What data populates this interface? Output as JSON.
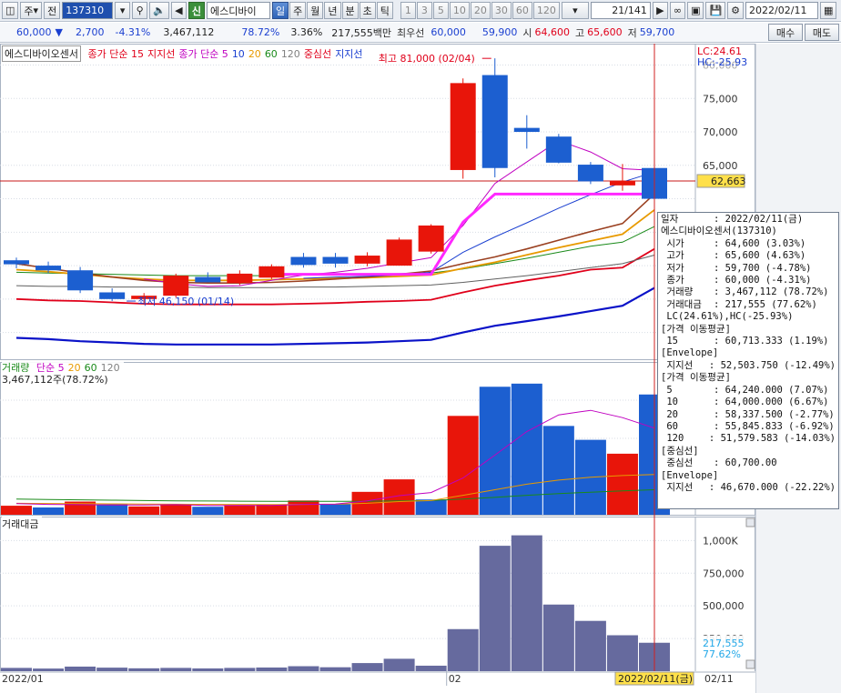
{
  "toolbar": {
    "market": "주",
    "scope": "전",
    "code": "137310",
    "stock_name": "에스디바이",
    "new_badge": "신",
    "periods": [
      {
        "label": "일",
        "active": true
      },
      {
        "label": "주",
        "active": false
      },
      {
        "label": "월",
        "active": false
      },
      {
        "label": "년",
        "active": false
      },
      {
        "label": "분",
        "active": false
      },
      {
        "label": "초",
        "active": false
      },
      {
        "label": "틱",
        "active": false
      }
    ],
    "intervals": [
      "1",
      "3",
      "5",
      "10",
      "20",
      "30",
      "60",
      "120"
    ],
    "page": "21/141",
    "date": "2022/02/11"
  },
  "price_row": {
    "price": "60,000",
    "down_arrow": "▼",
    "change": "2,700",
    "change_pct": "-4.31%",
    "volume": "3,467,112",
    "volume_ratio": "78.72%",
    "turnover_pct": "3.36%",
    "amount": "217,555백만",
    "best_label": "최우선",
    "best_price": "60,000",
    "best_price2": "59,900",
    "open_label": "시",
    "open": "64,600",
    "high_label": "고",
    "high": "65,600",
    "low_label": "저",
    "low": "59,700",
    "buy_label": "매수",
    "sell_label": "매도"
  },
  "price_panel": {
    "legend_name": "에스디바이오센서",
    "legend_items": [
      {
        "text": "종가 단순 15",
        "color": "#e0001a"
      },
      {
        "text": "지지선",
        "color": "#e0001a"
      },
      {
        "text": "종가 단순 5",
        "color": "#c000c0"
      },
      {
        "text": "10",
        "color": "#1a3fd0"
      },
      {
        "text": "20",
        "color": "#e89a00"
      },
      {
        "text": "60",
        "color": "#1a8a1a"
      },
      {
        "text": "120",
        "color": "#808080"
      },
      {
        "text": "중심선",
        "color": "#e0001a"
      },
      {
        "text": "지지선",
        "color": "#1a3fd0"
      }
    ],
    "high_note": "최고 81,000 (02/04)",
    "low_note": "최저 46,150 (01/14)",
    "lc": "LC:24.61",
    "hc": "HC:-25.93",
    "y_ticks": [
      "75,000",
      "70,000",
      "65,000",
      "80,000"
    ],
    "current_price_tag": "62,663"
  },
  "volume_panel": {
    "legend_title": "거래량",
    "legend_items": [
      {
        "text": "단순 5",
        "color": "#c000c0"
      },
      {
        "text": "20",
        "color": "#e89a00"
      },
      {
        "text": "60",
        "color": "#1a8a1a"
      },
      {
        "text": "120",
        "color": "#808080"
      }
    ],
    "current_label": "3,467,112주(78.72%)"
  },
  "amount_panel": {
    "legend_title": "거래대금",
    "y_ticks": [
      "1,000K",
      "750,000",
      "500,000",
      "250,000"
    ],
    "current_tag": "217,555",
    "current_pct": "77.62%"
  },
  "x_axis": {
    "labels": [
      "2022/01",
      "02"
    ],
    "cursor_date": "2022/02/11(금)",
    "right_label": "02/11"
  },
  "popup": {
    "lines": [
      {
        "k": "일자",
        "v": ": 2022/02/11(금)"
      },
      {
        "k": "",
        "v": "에스디바이오센서(137310)"
      },
      {
        "k": " 시가",
        "v": ": 64,600 (3.03%)"
      },
      {
        "k": " 고가",
        "v": ": 65,600 (4.63%)"
      },
      {
        "k": " 저가",
        "v": ": 59,700 (-4.78%)"
      },
      {
        "k": " 종가",
        "v": ": 60,000 (-4.31%)"
      },
      {
        "k": " 거래량",
        "v": ": 3,467,112 (78.72%)"
      },
      {
        "k": " 거래대금",
        "v": ": 217,555 (77.62%)"
      },
      {
        "k": "",
        "v": " LC(24.61%),HC(-25.93%)"
      },
      {
        "k": "",
        "v": "[가격 이동평균]"
      },
      {
        "k": " 15",
        "v": ": 60,713.333 (1.19%)"
      },
      {
        "k": "",
        "v": "[Envelope]"
      },
      {
        "k": " 지지선",
        "v": ": 52,503.750 (-12.49%)"
      },
      {
        "k": "",
        "v": "[가격 이동평균]"
      },
      {
        "k": " 5",
        "v": ": 64,240.000 (7.07%)"
      },
      {
        "k": " 10",
        "v": ": 64,000.000 (6.67%)"
      },
      {
        "k": " 20",
        "v": ": 58,337.500 (-2.77%)"
      },
      {
        "k": " 60",
        "v": ": 55,845.833 (-6.92%)"
      },
      {
        "k": " 120",
        "v": ": 51,579.583 (-14.03%)"
      },
      {
        "k": "",
        "v": "[중심선]"
      },
      {
        "k": " 중심선",
        "v": ": 60,700.00"
      },
      {
        "k": "",
        "v": "[Envelope]"
      },
      {
        "k": " 지지선",
        "v": ": 46,670.000 (-22.22%)"
      }
    ]
  },
  "colors": {
    "up": "#e8150a",
    "down": "#1c5fd0",
    "ma5": "#c000c0",
    "ma10": "#1a3fd0",
    "ma20": "#e89a00",
    "ma60": "#1a8a1a",
    "ma120": "#606060",
    "ma15": "#9a4020",
    "center": "#ff28ff",
    "env_upper": "#e0001a",
    "env_lower": "#0a12c8",
    "amount_bar": "#666a9e"
  },
  "chart_data": {
    "type": "candlestick",
    "candles": [
      {
        "o": 50800,
        "h": 51200,
        "l": 49600,
        "c": 50200
      },
      {
        "o": 50000,
        "h": 50600,
        "l": 48900,
        "c": 49300
      },
      {
        "o": 49300,
        "h": 49800,
        "l": 45900,
        "c": 46300
      },
      {
        "o": 46000,
        "h": 46600,
        "l": 44700,
        "c": 45000
      },
      {
        "o": 45000,
        "h": 45900,
        "l": 44200,
        "c": 45500
      },
      {
        "o": 45500,
        "h": 48800,
        "l": 45200,
        "c": 48500
      },
      {
        "o": 48300,
        "h": 49000,
        "l": 47500,
        "c": 47500
      },
      {
        "o": 47400,
        "h": 49300,
        "l": 47100,
        "c": 48800
      },
      {
        "o": 48200,
        "h": 50200,
        "l": 48000,
        "c": 49900
      },
      {
        "o": 51300,
        "h": 51900,
        "l": 49700,
        "c": 50100
      },
      {
        "o": 51300,
        "h": 51900,
        "l": 49700,
        "c": 50300
      },
      {
        "o": 50300,
        "h": 52000,
        "l": 49900,
        "c": 51500
      },
      {
        "o": 50000,
        "h": 54200,
        "l": 50000,
        "c": 53900
      },
      {
        "o": 52100,
        "h": 56200,
        "l": 51800,
        "c": 56000
      },
      {
        "o": 64300,
        "h": 78000,
        "l": 63000,
        "c": 77300
      },
      {
        "o": 78500,
        "h": 81000,
        "l": 63200,
        "c": 64600
      },
      {
        "o": 70600,
        "h": 72500,
        "l": 67500,
        "c": 70000
      },
      {
        "o": 69300,
        "h": 69700,
        "l": 65300,
        "c": 65400
      },
      {
        "o": 65100,
        "h": 65500,
        "l": 62200,
        "c": 62600
      },
      {
        "o": 62000,
        "h": 65200,
        "l": 61200,
        "c": 62700
      },
      {
        "o": 64600,
        "h": 65600,
        "l": 59700,
        "c": 60000
      }
    ],
    "ma5": [
      null,
      null,
      null,
      null,
      48000,
      47300,
      46900,
      47000,
      47800,
      48600,
      49000,
      49600,
      50400,
      51200,
      56000,
      62300,
      65500,
      68700,
      67000,
      64500,
      64240
    ],
    "ma10": [
      null,
      null,
      null,
      null,
      null,
      null,
      null,
      null,
      null,
      48100,
      48300,
      48400,
      48600,
      49000,
      52000,
      54300,
      56400,
      58600,
      60600,
      62500,
      64000
    ],
    "ma20": [
      49400,
      49100,
      48700,
      48300,
      48000,
      47800,
      47800,
      47800,
      47900,
      48000,
      48100,
      48200,
      48400,
      48600,
      49600,
      50500,
      51600,
      52700,
      53700,
      54700,
      58337
    ],
    "ma60": [
      49000,
      48900,
      48800,
      48700,
      48600,
      48500,
      48500,
      48500,
      48500,
      48600,
      48600,
      48700,
      48800,
      48900,
      49500,
      50300,
      51100,
      52000,
      52900,
      53500,
      55846
    ],
    "ma120": [
      47000,
      46900,
      46900,
      46800,
      46800,
      46800,
      46700,
      46700,
      46700,
      46800,
      46800,
      46900,
      47000,
      47100,
      47500,
      48000,
      48500,
      49100,
      49700,
      50300,
      51580
    ],
    "ma15": [
      50300,
      49600,
      48900,
      48300,
      47800,
      47500,
      47400,
      47400,
      47500,
      47700,
      48000,
      48300,
      48700,
      49200,
      50300,
      51300,
      52500,
      53800,
      55100,
      56300,
      60713
    ],
    "center": [
      null,
      null,
      null,
      null,
      null,
      null,
      null,
      null,
      48700,
      48700,
      48700,
      48700,
      48700,
      48700,
      56500,
      60700,
      60700,
      60700,
      60700,
      60700,
      60700
    ],
    "env_upper": [
      45000,
      44800,
      44700,
      44500,
      44300,
      44200,
      44200,
      44200,
      44200,
      44300,
      44400,
      44600,
      44700,
      44900,
      46000,
      47000,
      47800,
      48500,
      49400,
      49700,
      52504
    ],
    "env_lower": [
      39200,
      39000,
      38700,
      38500,
      38300,
      38200,
      38200,
      38200,
      38200,
      38300,
      38400,
      38500,
      38700,
      38900,
      40000,
      41000,
      41700,
      42400,
      43200,
      44000,
      46670
    ],
    "volume": [
      260000,
      210000,
      380000,
      300000,
      240000,
      280000,
      230000,
      280000,
      300000,
      410000,
      310000,
      660000,
      1020000,
      440000,
      2850000,
      3690000,
      3780000,
      2560000,
      2160000,
      1760000,
      3467112
    ],
    "volume_up": [
      true,
      false,
      true,
      false,
      true,
      true,
      false,
      true,
      true,
      true,
      false,
      true,
      true,
      false,
      true,
      false,
      false,
      false,
      false,
      true,
      false
    ],
    "volume_ma5": [
      320000,
      300000,
      290000,
      280000,
      280000,
      290000,
      270000,
      270000,
      270000,
      300000,
      310000,
      400000,
      550000,
      640000,
      1060000,
      1720000,
      2400000,
      2880000,
      3010000,
      2800000,
      2500000
    ],
    "volume_ma20": [
      330000,
      325000,
      320000,
      315000,
      310000,
      305000,
      300000,
      298000,
      297000,
      300000,
      305000,
      330000,
      380000,
      410000,
      560000,
      720000,
      880000,
      1000000,
      1080000,
      1130000,
      1160000
    ],
    "volume_ma60": [
      450000,
      440000,
      430000,
      420000,
      410000,
      400000,
      395000,
      390000,
      385000,
      385000,
      385000,
      390000,
      400000,
      410000,
      450000,
      500000,
      560000,
      610000,
      650000,
      690000,
      720000
    ],
    "amount": [
      25000,
      20000,
      35000,
      27000,
      22000,
      25000,
      21000,
      25000,
      28000,
      38000,
      30000,
      62000,
      95000,
      42000,
      322000,
      960000,
      1040000,
      510000,
      385000,
      275000,
      217555
    ],
    "price_range": [
      36000,
      83200
    ],
    "volume_range": [
      0,
      4300000
    ],
    "amount_range": [
      0,
      1100000
    ]
  }
}
